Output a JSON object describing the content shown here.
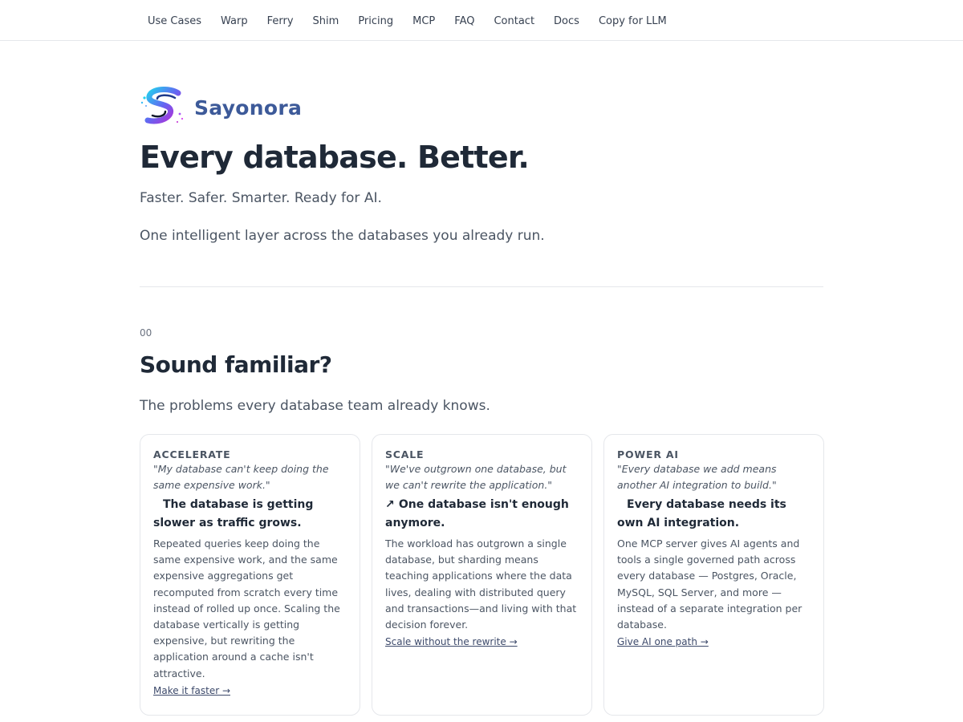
{
  "nav": {
    "items": [
      "Use Cases",
      "Warp",
      "Ferry",
      "Shim",
      "Pricing",
      "MCP",
      "FAQ",
      "Contact",
      "Docs",
      "Copy for LLM"
    ]
  },
  "brand": {
    "name": "Sayonora",
    "logo_icon": "swirl-s-logo",
    "color": "#3d5a99"
  },
  "hero": {
    "title": "Every database. Better.",
    "subtitle": "Faster. Safer. Smarter. Ready for AI.",
    "description": "One intelligent layer across the databases you already run."
  },
  "section": {
    "number": "00",
    "title": "Sound familiar?",
    "subtitle": "The problems every database team already knows."
  },
  "cards": [
    {
      "tag": "ACCELERATE",
      "quote": "\"My database can't keep doing the same expensive work.\"",
      "icon": "",
      "heading": "The database is getting slower as traffic grows.",
      "body": "Repeated queries keep doing the same expensive work, and the same expensive aggregations get recomputed from scratch every time instead of rolled up once. Scaling the database vertically is getting expensive, but rewriting the application around a cache isn't attractive.",
      "link": "Make it faster →"
    },
    {
      "tag": "SCALE",
      "quote": "\"We've outgrown one database, but we can't rewrite the application.\"",
      "icon": "↗",
      "heading": "One database isn't enough anymore.",
      "body": "The workload has outgrown a single database, but sharding means teaching applications where the data lives, dealing with distributed query and transactions—and living with that decision forever.",
      "link": "Scale without the rewrite →"
    },
    {
      "tag": "POWER AI",
      "quote": "\"Every database we add means another AI integration to build.\"",
      "icon": "",
      "heading": "Every database needs its own AI integration.",
      "body": "One MCP server gives AI agents and tools a single governed path across every database — Postgres, Oracle, MySQL, SQL Server, and more — instead of a separate integration per database.",
      "link": "Give AI one path →"
    }
  ]
}
